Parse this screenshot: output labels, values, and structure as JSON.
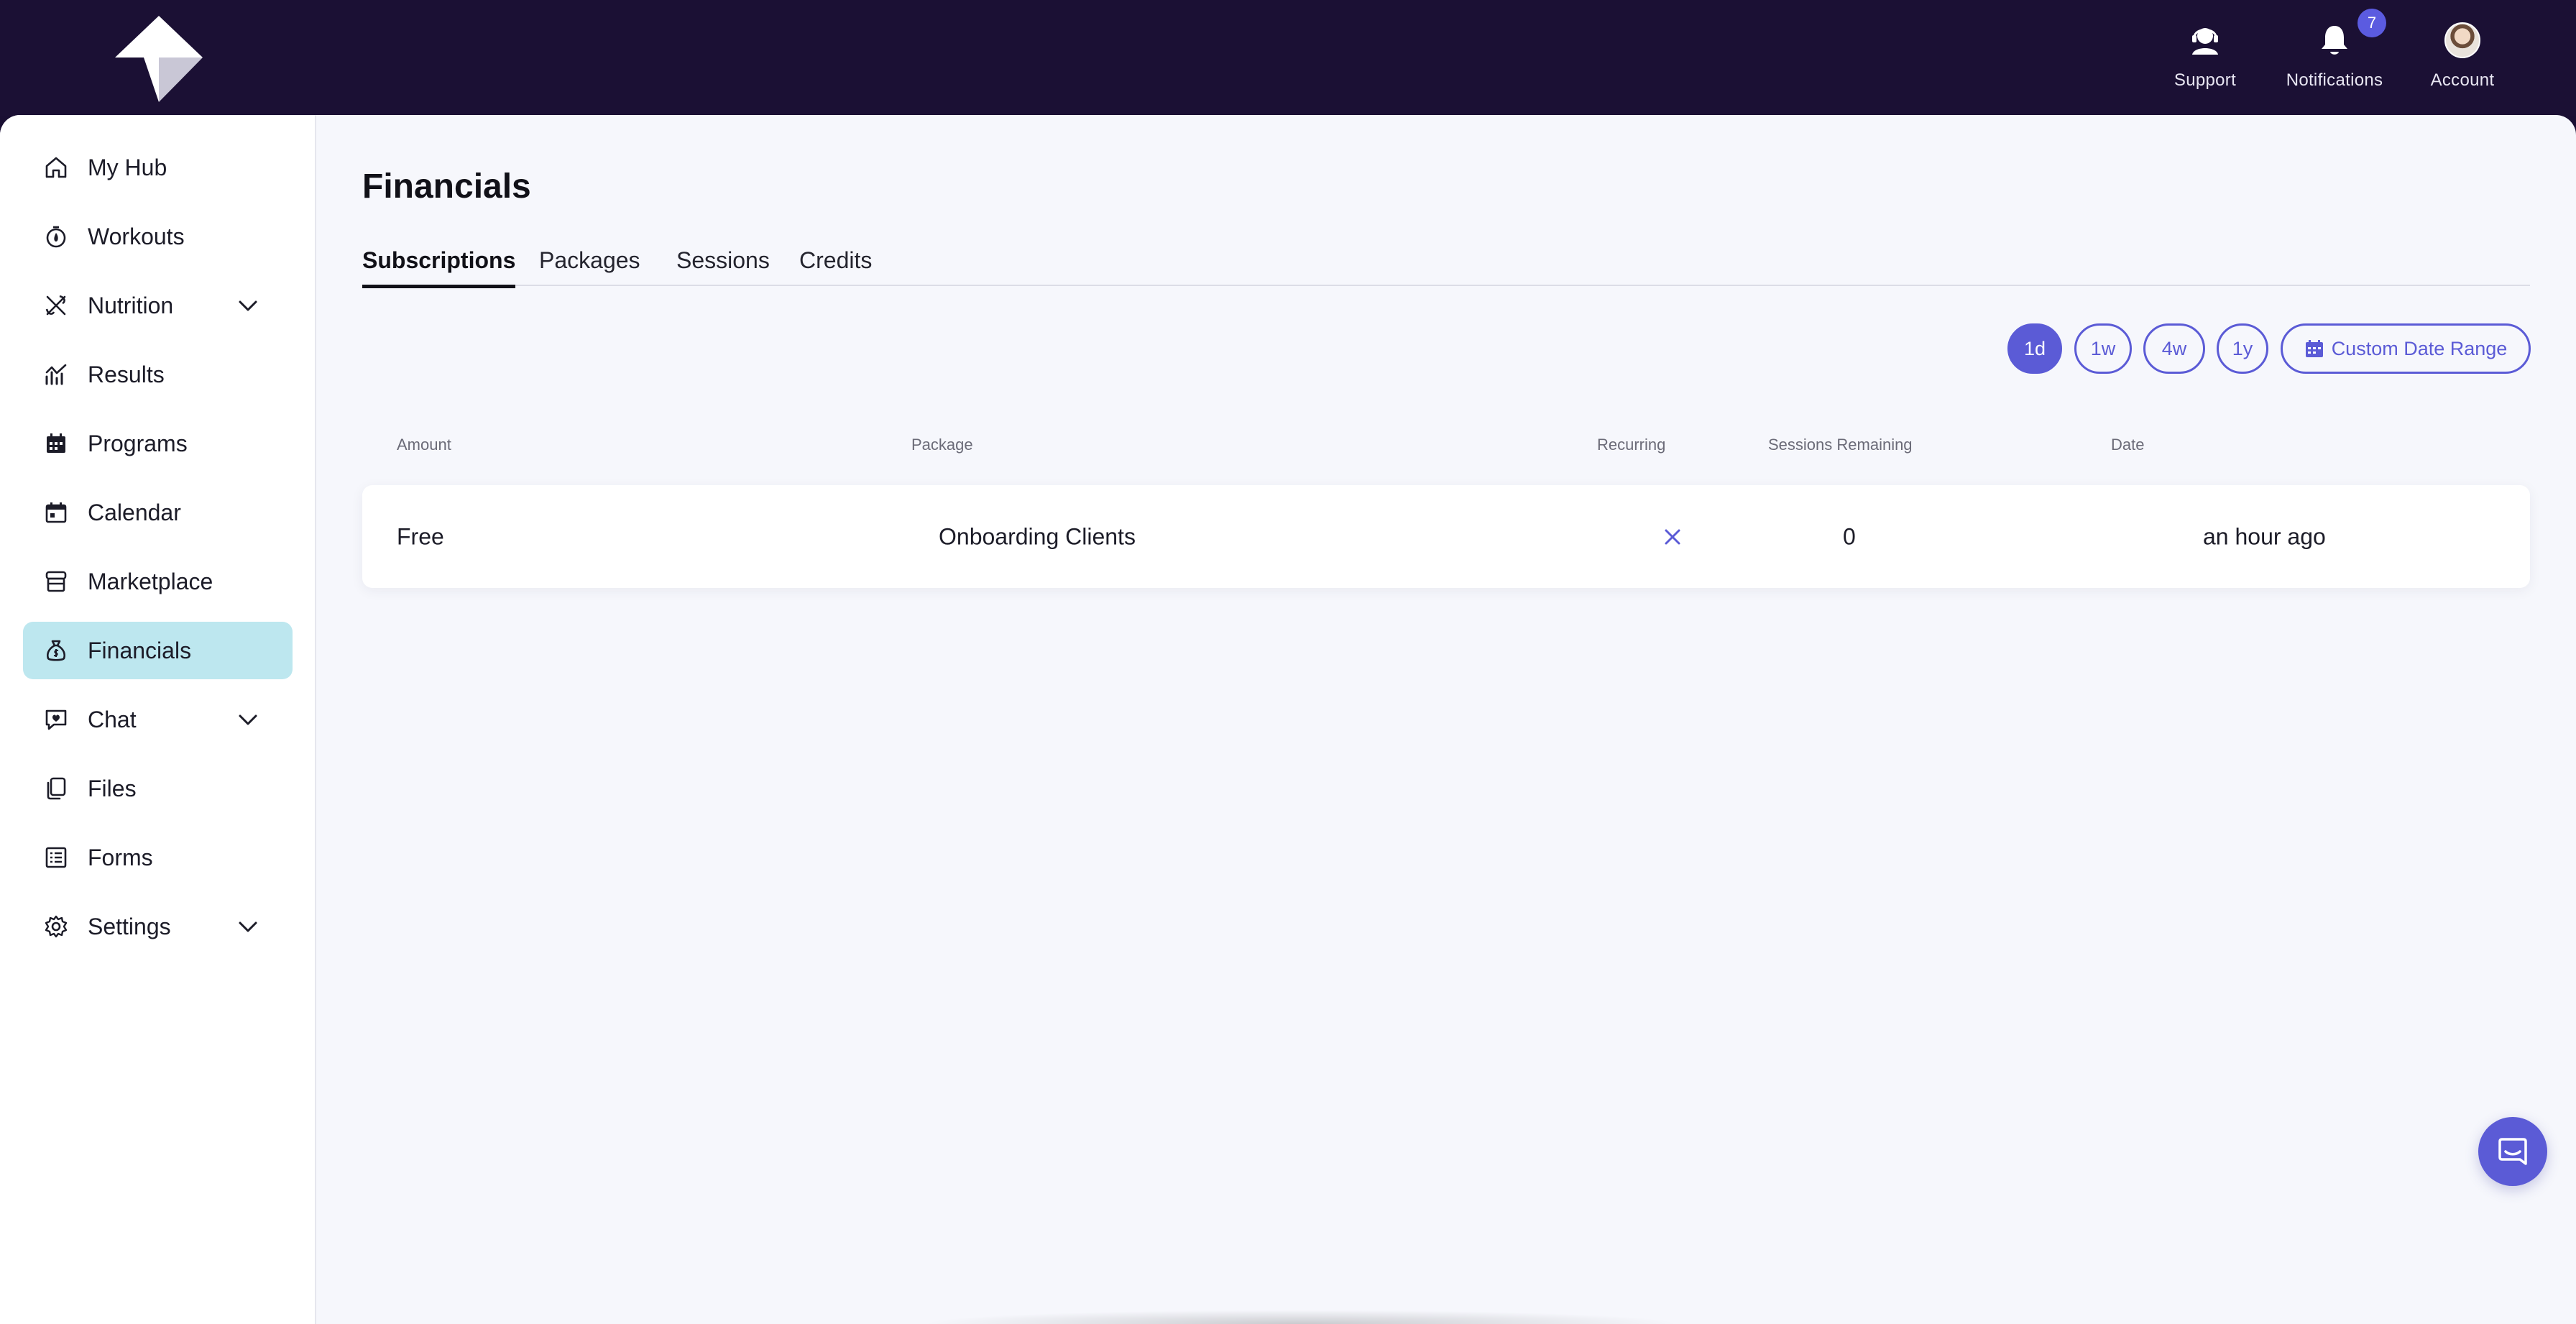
{
  "header": {
    "support_label": "Support",
    "notifications_label": "Notifications",
    "notifications_count": "7",
    "account_label": "Account"
  },
  "sidebar": {
    "items": [
      {
        "label": "My Hub",
        "icon": "home-icon"
      },
      {
        "label": "Workouts",
        "icon": "workouts-icon"
      },
      {
        "label": "Nutrition",
        "icon": "nutrition-icon",
        "expandable": true
      },
      {
        "label": "Results",
        "icon": "results-icon"
      },
      {
        "label": "Programs",
        "icon": "programs-icon"
      },
      {
        "label": "Calendar",
        "icon": "calendar-icon"
      },
      {
        "label": "Marketplace",
        "icon": "marketplace-icon"
      },
      {
        "label": "Financials",
        "icon": "financials-icon",
        "active": true
      },
      {
        "label": "Chat",
        "icon": "chat-icon",
        "expandable": true
      },
      {
        "label": "Files",
        "icon": "files-icon"
      },
      {
        "label": "Forms",
        "icon": "forms-icon"
      },
      {
        "label": "Settings",
        "icon": "settings-icon",
        "expandable": true
      }
    ]
  },
  "main": {
    "title": "Financials",
    "tabs": [
      {
        "label": "Subscriptions",
        "active": true
      },
      {
        "label": "Packages"
      },
      {
        "label": "Sessions"
      },
      {
        "label": "Credits"
      }
    ],
    "range_buttons": [
      {
        "label": "1d",
        "active": true
      },
      {
        "label": "1w"
      },
      {
        "label": "4w"
      },
      {
        "label": "1y"
      },
      {
        "label": "Custom Date Range",
        "icon": "calendar-icon"
      }
    ],
    "table": {
      "columns": [
        "Amount",
        "Package",
        "Recurring",
        "Sessions Remaining",
        "Date"
      ],
      "rows": [
        {
          "amount": "Free",
          "package": "Onboarding Clients",
          "recurring_icon": "x-icon",
          "sessions_remaining": "0",
          "date": "an hour ago"
        }
      ]
    }
  },
  "colors": {
    "topbar": "#1b1034",
    "accent": "#5b5bd6",
    "active_nav": "#bde7ef",
    "content_bg": "#f6f7fc"
  }
}
